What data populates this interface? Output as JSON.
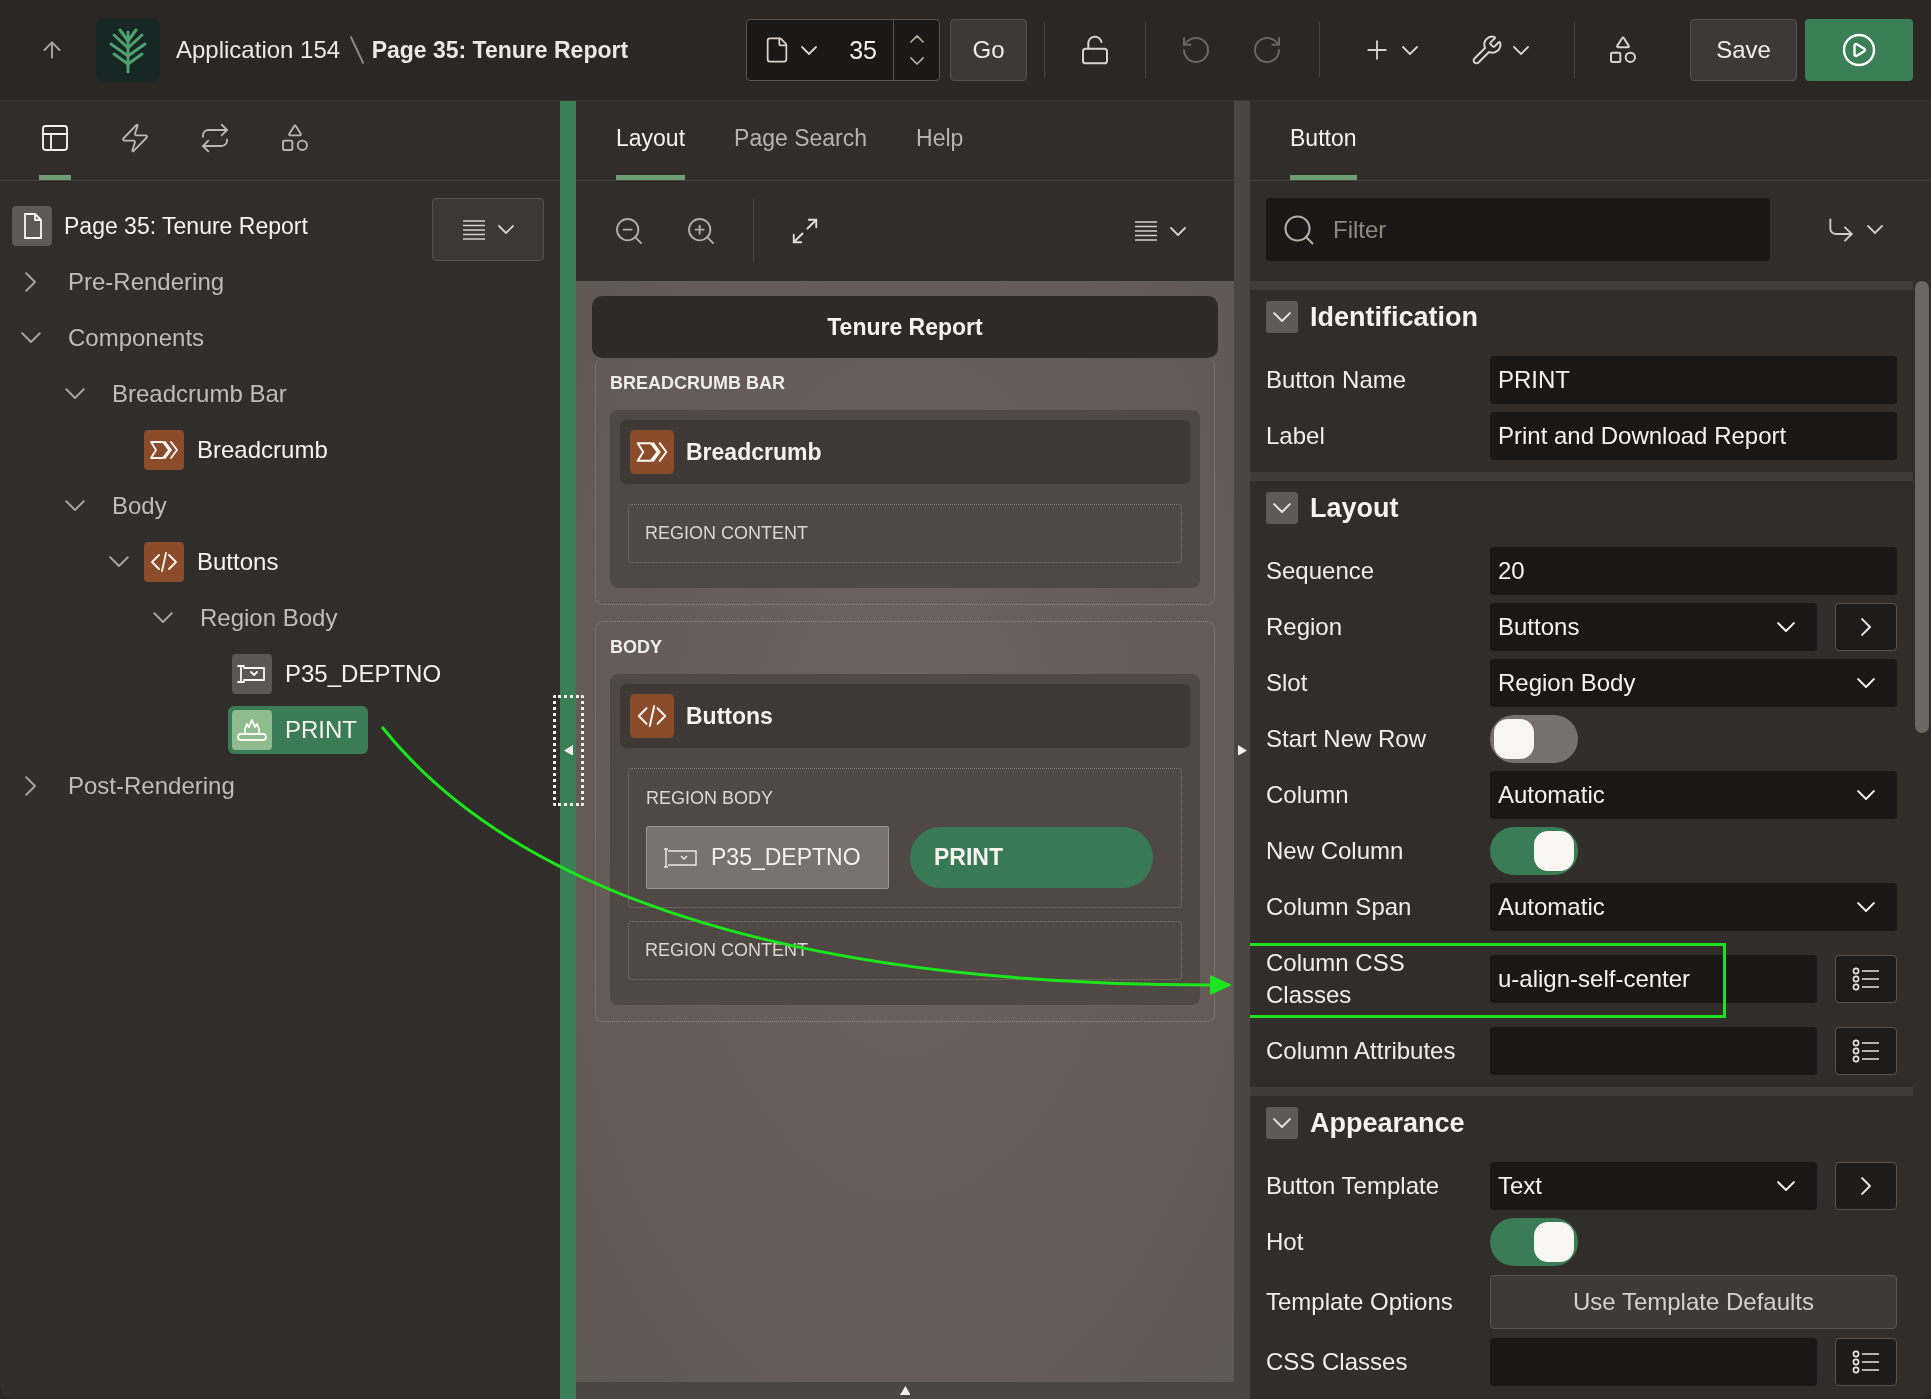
{
  "top_bar": {
    "app_name": "Application 154",
    "page_title": "Page 35: Tenure Report",
    "page_number": "35",
    "go_button": "Go",
    "undo_button": {
      "disabled": true
    },
    "redo_button": {
      "disabled": true
    },
    "save_button": "Save"
  },
  "tree_panel": {
    "tabs": [
      {
        "selected": true
      },
      {
        "selected": false
      },
      {
        "selected": false
      },
      {
        "selected": false
      }
    ],
    "root": {
      "label": "Page 35: Tenure Report",
      "selected": false,
      "children": [
        {
          "kind": "group",
          "label": "Pre-Rendering",
          "expanded": false,
          "selected": false
        },
        {
          "kind": "group",
          "label": "Components",
          "expanded": true,
          "selected": false,
          "children": [
            {
              "kind": "group",
              "label": "Breadcrumb Bar",
              "expanded": true,
              "selected": false,
              "children": [
                {
                  "kind": "breadcrumb",
                  "label": "Breadcrumb",
                  "selected": false
                }
              ]
            },
            {
              "kind": "group",
              "label": "Body",
              "expanded": true,
              "selected": false,
              "children": [
                {
                  "kind": "static",
                  "label": "Buttons",
                  "expanded": true,
                  "selected": false,
                  "children": [
                    {
                      "kind": "group",
                      "label": "Region Body",
                      "expanded": true,
                      "selected": false,
                      "children": [
                        {
                          "kind": "item",
                          "label": "P35_DEPTNO",
                          "selected": false
                        },
                        {
                          "kind": "button",
                          "label": "PRINT",
                          "selected": true
                        }
                      ]
                    }
                  ]
                }
              ]
            }
          ]
        },
        {
          "kind": "group",
          "label": "Post-Rendering",
          "expanded": false,
          "selected": false
        }
      ]
    }
  },
  "layout_panel": {
    "tabs": [
      {
        "label": "Layout",
        "selected": true
      },
      {
        "label": "Page Search",
        "selected": false
      },
      {
        "label": "Help",
        "selected": false
      }
    ],
    "page_title": "Tenure Report",
    "regions": [
      {
        "label": "BREADCRUMB BAR",
        "components": [
          {
            "kind": "breadcrumb",
            "title": "Breadcrumb",
            "slots": [
              {
                "label": "REGION CONTENT"
              }
            ]
          }
        ]
      },
      {
        "label": "BODY",
        "components": [
          {
            "kind": "static",
            "title": "Buttons",
            "slots": [
              {
                "label": "REGION BODY",
                "items": [
                  {
                    "kind": "item",
                    "label": "P35_DEPTNO"
                  },
                  {
                    "kind": "button",
                    "label": "PRINT"
                  }
                ]
              },
              {
                "label": "REGION CONTENT"
              }
            ]
          }
        ]
      }
    ]
  },
  "property_editor": {
    "tabs": [
      {
        "label": "Button",
        "selected": true
      }
    ],
    "filter": {
      "placeholder": "Filter"
    },
    "groups": [
      {
        "title": "Identification",
        "expanded": true,
        "properties": [
          {
            "kind": "text",
            "label": "Button Name",
            "value": "PRINT",
            "highlighted": false
          },
          {
            "kind": "text",
            "label": "Label",
            "value": "Print and Download Report",
            "highlighted": false
          }
        ]
      },
      {
        "title": "Layout",
        "expanded": true,
        "properties": [
          {
            "kind": "text",
            "label": "Sequence",
            "value": "20",
            "highlighted": false
          },
          {
            "kind": "select_link",
            "label": "Region",
            "value": "Buttons",
            "highlighted": false
          },
          {
            "kind": "select",
            "label": "Slot",
            "value": "Region Body",
            "highlighted": false
          },
          {
            "kind": "switch",
            "label": "Start New Row",
            "on": false,
            "highlighted": false
          },
          {
            "kind": "select",
            "label": "Column",
            "value": "Automatic",
            "highlighted": false
          },
          {
            "kind": "switch",
            "label": "New Column",
            "on": true,
            "highlighted": false
          },
          {
            "kind": "select",
            "label": "Column Span",
            "value": "Automatic",
            "highlighted": false
          },
          {
            "kind": "text_list",
            "label": "Column CSS Classes",
            "value": "u-align-self-center",
            "highlighted": true
          },
          {
            "kind": "text_list",
            "label": "Column Attributes",
            "highlighted": false
          }
        ]
      },
      {
        "title": "Appearance",
        "expanded": true,
        "properties": [
          {
            "kind": "select_link",
            "label": "Button Template",
            "value": "Text",
            "highlighted": false
          },
          {
            "kind": "switch",
            "label": "Hot",
            "on": true,
            "highlighted": false
          },
          {
            "kind": "button",
            "label": "Template Options",
            "value": "Use Template Defaults",
            "highlighted": false
          },
          {
            "kind": "text_list",
            "label": "CSS Classes",
            "highlighted": false
          }
        ]
      }
    ]
  }
}
